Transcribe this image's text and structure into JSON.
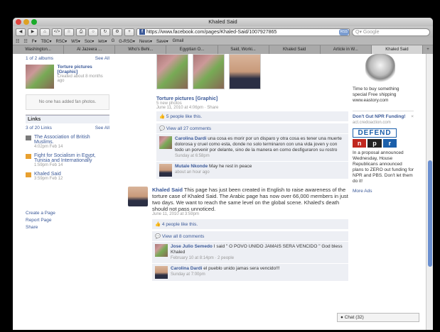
{
  "window": {
    "title": "Khaled Said",
    "url": "https://www.facebook.com/pages/Khaled-Said/1007927865",
    "search_placeholder": "Google",
    "rss": "RSS"
  },
  "bookmarks": [
    "F▾",
    "TBC▾",
    "RSC▾",
    "WS▾",
    "Soc▾",
    "lets▾",
    "G",
    "G-RSG▾",
    "News▾",
    "Save▾",
    "Gmail"
  ],
  "tabs": [
    "Washington...",
    "Al Jazeera ...",
    "Who's Behi...",
    "Egyptian O...",
    "Said, Worki...",
    "Khaled Said",
    "Article in W...",
    "Khaled Said"
  ],
  "left": {
    "albums_summary": "1 of 2 albums",
    "see_all": "See All",
    "album_title": "Torture pictures [Graphic]",
    "album_created": "Created about 8 months ago",
    "no_fans": "No one has added fan photos.",
    "links_title": "Links",
    "links_summary": "3 of 20 Links",
    "links": [
      {
        "title": "The Association of British Muslims.",
        "time": "4:02pm Feb 14"
      },
      {
        "title": "Fight for Socialism in Egypt, Tunisia and Internationally",
        "time": "1:59pm Feb 14"
      },
      {
        "title": "Khaled Said",
        "time": "3:59pm Feb 12"
      }
    ],
    "bottom_links": [
      "Create a Page",
      "Report Page",
      "Share"
    ]
  },
  "post1": {
    "title": "Torture pictures [Graphic]",
    "subtitle": "5 new photos",
    "time": "June 11, 2010 at 4:06pm · Share",
    "likes": "5 people like this.",
    "view_comments": "View all 27 comments",
    "comments": [
      {
        "name": "Carolina Dardi",
        "text": "una cosa es morir por un disparo y otra cosa es tener una muerte dolorosa y cruel como esta, donde no solo terminaron con una vida joven y con todo un porvenir por delante, sino de la manera en como desfiguraron su rostro",
        "time": "Sunday at 6:58pm"
      },
      {
        "name": "Mutale Nkonde",
        "text": "May he rest in peace",
        "time": "about an hour ago"
      }
    ]
  },
  "post2": {
    "author": "Khaled Said",
    "text": "This page has just been created in English to raise awareness of the torture case of Khaled Said. The Arabic page has now over 66,000 members in just two days. We want to reach the same level on the global scene. Khaled's death should not pass unnoticed.",
    "time": "June 11, 2010 at 3:59pm",
    "likes": "4 people like this.",
    "view_comments": "View all 8 comments",
    "comments": [
      {
        "name": "Jose Julio Semedo",
        "text": "I said \" O POVO UNIDO JAMAIS SERA VENCIDO \" God bless Khaled",
        "time": "February 10 at 8:14pm · 2 people"
      },
      {
        "name": "Carolina Dardi",
        "text": "el pueblo unido jamas sera vencido!!!",
        "time": "Sunday at 7:00pm"
      }
    ]
  },
  "right": {
    "ad1_text": "Time to buy something special Free shipping www.eastory.com",
    "ad2_title": "Don't Gut NPR Funding!",
    "ad2_url": "act.credoaction.com",
    "defend": "DEFEND",
    "npr_letters": [
      "n",
      "p",
      "r"
    ],
    "ad2_text": "In a proposal announced Wednesday, House Republicans announced plans to ZERO out funding for NPR and PBS. Don't let them do it!",
    "more_ads": "More Ads",
    "close": "×"
  },
  "chat": {
    "label": "Chat (32)"
  },
  "colors": {
    "fb_blue": "#3b5998",
    "npr_red": "#c0271e",
    "npr_black": "#222222",
    "npr_blue": "#1b5faa"
  }
}
